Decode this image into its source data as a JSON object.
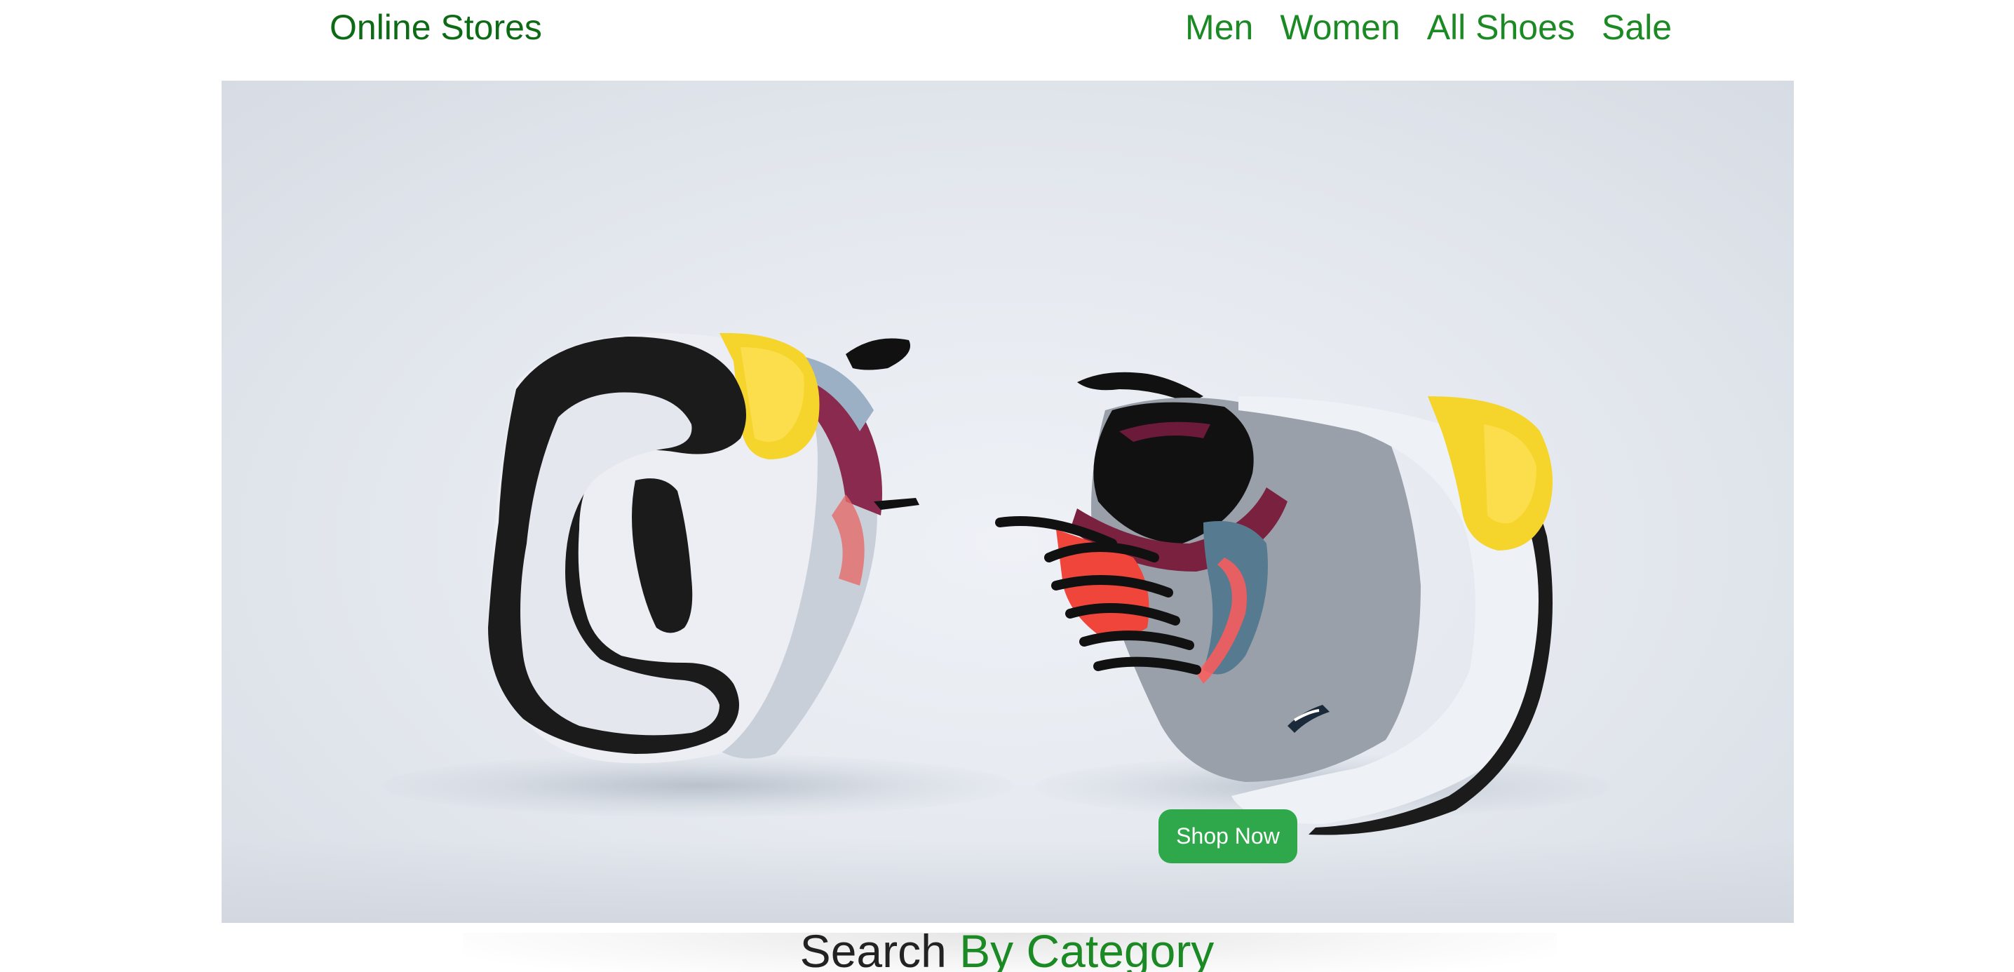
{
  "brand": {
    "name": "Online Stores"
  },
  "nav": {
    "items": [
      {
        "label": "Men"
      },
      {
        "label": "Women"
      },
      {
        "label": "All Shoes"
      },
      {
        "label": "Sale"
      }
    ]
  },
  "hero": {
    "image": "pair-of-sneakers-photo",
    "button_label": "Shop Now"
  },
  "category_section": {
    "title_part1": "Search",
    "title_part2": "By Category"
  },
  "colors": {
    "brand_green": "#0e6b15",
    "nav_green": "#1c8a24",
    "button_green": "#2ea84a",
    "hero_bg": "#e6eaf0"
  }
}
